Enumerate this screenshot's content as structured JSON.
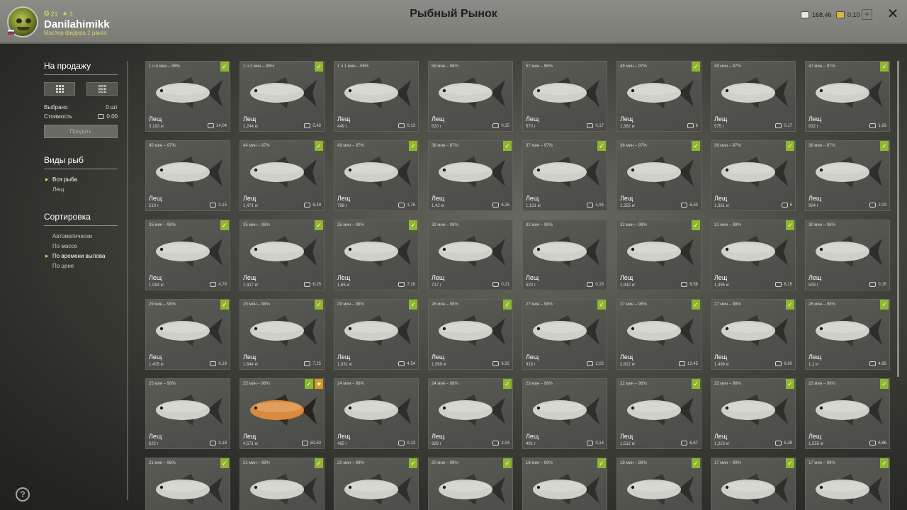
{
  "header": {
    "title": "Рыбный Рынок",
    "username": "Danilahimikk",
    "rank": "Мастер фидера 2 ранга",
    "level": "21",
    "stars": "3",
    "silver": "168,46",
    "gold": "0,10"
  },
  "sidebar": {
    "for_sale_title": "На продажу",
    "selected_label": "Выбрано",
    "selected_value": "0 шт",
    "cost_label": "Стоимость",
    "cost_value": "0.00",
    "sell_button": "Продать",
    "species_title": "Виды рыб",
    "species": [
      {
        "label": "Вся рыба",
        "active": true
      },
      {
        "label": "Лещ",
        "active": false
      }
    ],
    "sort_title": "Сортировка",
    "sort_options": [
      {
        "label": "Автоматически",
        "active": false
      },
      {
        "label": "По массе",
        "active": false
      },
      {
        "label": "По времени вылова",
        "active": true
      },
      {
        "label": "По цене",
        "active": false
      }
    ]
  },
  "colors": {
    "badge_green": "#8fb62e",
    "badge_gold": "#d29a22",
    "fish_silver": "#cfd0c8",
    "fish_orange": "#d98a3c"
  },
  "fish_cards": [
    {
      "time": "1 ч 4 мин – 96%",
      "name": "Лещ",
      "weight": "3,183 кг",
      "price": "14,04",
      "check": true,
      "star": false,
      "orange": false
    },
    {
      "time": "1 ч 2 мин – 96%",
      "name": "Лещ",
      "weight": "1,244 кг",
      "price": "5,48",
      "check": true,
      "star": false,
      "orange": false
    },
    {
      "time": "1 ч 1 мин – 96%",
      "name": "Лещ",
      "weight": "449 г",
      "price": "0,13",
      "check": false,
      "star": false,
      "orange": false
    },
    {
      "time": "59 мин – 96%",
      "name": "Лещ",
      "weight": "520 г",
      "price": "0,15",
      "check": false,
      "star": false,
      "orange": false
    },
    {
      "time": "57 мин – 96%",
      "name": "Лещ",
      "weight": "570 г",
      "price": "0,17",
      "check": false,
      "star": false,
      "orange": false
    },
    {
      "time": "49 мин – 97%",
      "name": "Лещ",
      "weight": "1,362 кг",
      "price": "6",
      "check": true,
      "star": false,
      "orange": false
    },
    {
      "time": "49 мин – 97%",
      "name": "Лещ",
      "weight": "575 г",
      "price": "0,17",
      "check": false,
      "star": false,
      "orange": false
    },
    {
      "time": "47 мин – 97%",
      "name": "Лещ",
      "weight": "832 г",
      "price": "1,83",
      "check": true,
      "star": false,
      "orange": false
    },
    {
      "time": "45 мин – 97%",
      "name": "Лещ",
      "weight": "510 г",
      "price": "0,15",
      "check": false,
      "star": false,
      "orange": false
    },
    {
      "time": "44 мин – 97%",
      "name": "Лещ",
      "weight": "1,471 кг",
      "price": "6,49",
      "check": true,
      "star": false,
      "orange": false
    },
    {
      "time": "43 мин – 97%",
      "name": "Лещ",
      "weight": "798 г",
      "price": "1,76",
      "check": true,
      "star": false,
      "orange": false
    },
    {
      "time": "38 мин – 97%",
      "name": "Лещ",
      "weight": "1,42 кг",
      "price": "6,26",
      "check": true,
      "star": false,
      "orange": false
    },
    {
      "time": "37 мин – 97%",
      "name": "Лещ",
      "weight": "1,121 кг",
      "price": "4,94",
      "check": true,
      "star": false,
      "orange": false
    },
    {
      "time": "36 мин – 97%",
      "name": "Лещ",
      "weight": "1,255 кг",
      "price": "5,53",
      "check": true,
      "star": false,
      "orange": false
    },
    {
      "time": "36 мин – 97%",
      "name": "Лещ",
      "weight": "1,361 кг",
      "price": "6",
      "check": true,
      "star": false,
      "orange": false
    },
    {
      "time": "36 мин – 97%",
      "name": "Лещ",
      "weight": "924 г",
      "price": "2,03",
      "check": true,
      "star": false,
      "orange": false
    },
    {
      "time": "35 мин – 98%",
      "name": "Лещ",
      "weight": "1,084 кг",
      "price": "4,78",
      "check": true,
      "star": false,
      "orange": false
    },
    {
      "time": "35 мин – 98%",
      "name": "Лещ",
      "weight": "1,417 кг",
      "price": "6,25",
      "check": true,
      "star": false,
      "orange": false
    },
    {
      "time": "35 мин – 98%",
      "name": "Лещ",
      "weight": "1,65 кг",
      "price": "7,28",
      "check": true,
      "star": false,
      "orange": false
    },
    {
      "time": "33 мин – 98%",
      "name": "Лещ",
      "weight": "717 г",
      "price": "0,21",
      "check": false,
      "star": false,
      "orange": false
    },
    {
      "time": "32 мин – 98%",
      "name": "Лещ",
      "weight": "520 г",
      "price": "0,15",
      "check": false,
      "star": false,
      "orange": false
    },
    {
      "time": "32 мин – 98%",
      "name": "Лещ",
      "weight": "1,942 кг",
      "price": "8,56",
      "check": true,
      "star": false,
      "orange": false
    },
    {
      "time": "31 мин – 98%",
      "name": "Лещ",
      "weight": "1,395 кг",
      "price": "6,15",
      "check": true,
      "star": false,
      "orange": false
    },
    {
      "time": "30 мин – 98%",
      "name": "Лещ",
      "weight": "509 г",
      "price": "0,15",
      "check": false,
      "star": false,
      "orange": false
    },
    {
      "time": "29 мин – 98%",
      "name": "Лещ",
      "weight": "1,405 кг",
      "price": "6,19",
      "check": true,
      "star": false,
      "orange": false
    },
    {
      "time": "29 мин – 98%",
      "name": "Лещ",
      "weight": "1,644 кг",
      "price": "7,25",
      "check": true,
      "star": false,
      "orange": false
    },
    {
      "time": "29 мин – 98%",
      "name": "Лещ",
      "weight": "1,031 кг",
      "price": "4,54",
      "check": true,
      "star": false,
      "orange": false
    },
    {
      "time": "28 мин – 98%",
      "name": "Лещ",
      "weight": "1,569 кг",
      "price": "6,92",
      "check": true,
      "star": false,
      "orange": false
    },
    {
      "time": "27 мин – 98%",
      "name": "Лещ",
      "weight": "919 г",
      "price": "2,02",
      "check": true,
      "star": false,
      "orange": false
    },
    {
      "time": "27 мин – 98%",
      "name": "Лещ",
      "weight": "2,822 кг",
      "price": "12,45",
      "check": true,
      "star": false,
      "orange": false
    },
    {
      "time": "27 мин – 98%",
      "name": "Лещ",
      "weight": "1,498 кг",
      "price": "6,60",
      "check": true,
      "star": false,
      "orange": false
    },
    {
      "time": "26 мин – 98%",
      "name": "Лещ",
      "weight": "1,1 кг",
      "price": "4,85",
      "check": true,
      "star": false,
      "orange": false
    },
    {
      "time": "25 мин – 98%",
      "name": "Лещ",
      "weight": "622 г",
      "price": "0,18",
      "check": false,
      "star": false,
      "orange": false
    },
    {
      "time": "25 мин – 98%",
      "name": "Лещ",
      "weight": "4,571 кг",
      "price": "60,50",
      "check": true,
      "star": true,
      "orange": true
    },
    {
      "time": "24 мин – 98%",
      "name": "Лещ",
      "weight": "465 г",
      "price": "0,13",
      "check": false,
      "star": false,
      "orange": false
    },
    {
      "time": "24 мин – 98%",
      "name": "Лещ",
      "weight": "928 г",
      "price": "2,04",
      "check": true,
      "star": false,
      "orange": false
    },
    {
      "time": "23 мин – 98%",
      "name": "Лещ",
      "weight": "491 г",
      "price": "0,14",
      "check": false,
      "star": false,
      "orange": false
    },
    {
      "time": "22 мин – 98%",
      "name": "Лещ",
      "weight": "1,512 кг",
      "price": "6,67",
      "check": true,
      "star": false,
      "orange": false
    },
    {
      "time": "22 мин – 98%",
      "name": "Лещ",
      "weight": "1,223 кг",
      "price": "5,39",
      "check": true,
      "star": false,
      "orange": false
    },
    {
      "time": "22 мин – 98%",
      "name": "Лещ",
      "weight": "1,555 кг",
      "price": "6,86",
      "check": true,
      "star": false,
      "orange": false
    },
    {
      "time": "21 мин – 98%",
      "name": "Лещ",
      "weight": "",
      "price": "",
      "check": true,
      "star": false,
      "orange": false
    },
    {
      "time": "21 мин – 99%",
      "name": "Лещ",
      "weight": "",
      "price": "",
      "check": true,
      "star": false,
      "orange": false
    },
    {
      "time": "20 мин – 99%",
      "name": "Лещ",
      "weight": "",
      "price": "",
      "check": true,
      "star": false,
      "orange": false
    },
    {
      "time": "20 мин – 99%",
      "name": "Лещ",
      "weight": "",
      "price": "",
      "check": true,
      "star": false,
      "orange": false
    },
    {
      "time": "18 мин – 99%",
      "name": "Лещ",
      "weight": "",
      "price": "",
      "check": true,
      "star": false,
      "orange": false
    },
    {
      "time": "18 мин – 99%",
      "name": "Лещ",
      "weight": "",
      "price": "",
      "check": true,
      "star": false,
      "orange": false
    },
    {
      "time": "17 мин – 99%",
      "name": "Лещ",
      "weight": "",
      "price": "",
      "check": true,
      "star": false,
      "orange": false
    },
    {
      "time": "17 мин – 99%",
      "name": "Лещ",
      "weight": "",
      "price": "",
      "check": true,
      "star": false,
      "orange": false
    }
  ]
}
